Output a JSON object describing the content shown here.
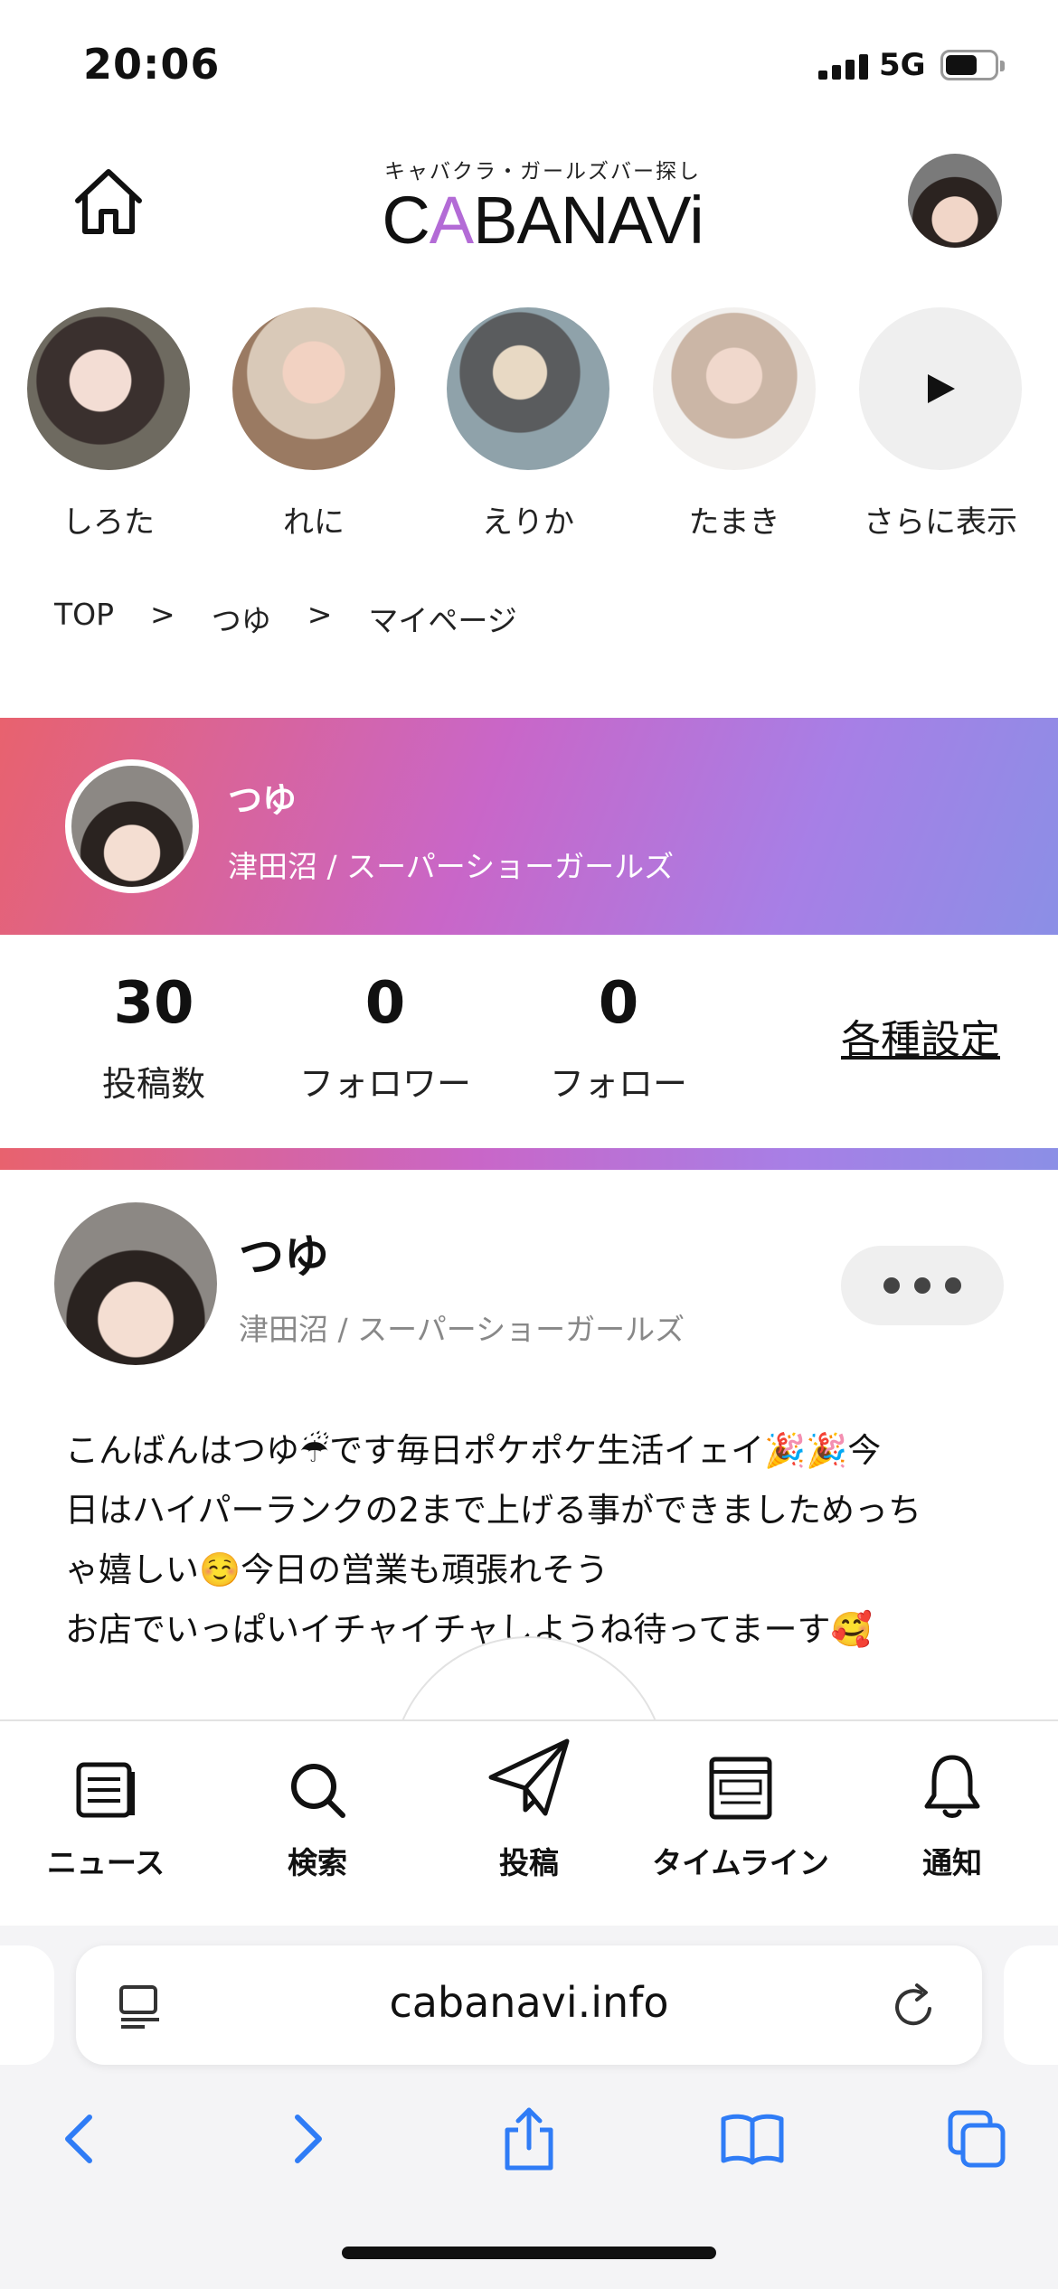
{
  "status_bar": {
    "time": "20:06",
    "network": "5G"
  },
  "header": {
    "logo_sub": "キャバクラ・ガールズバー探し",
    "logo_main_a": "C",
    "logo_main_accent": "A",
    "logo_main_b": "BANAVi"
  },
  "stories": [
    {
      "name": "しろた"
    },
    {
      "name": "れに"
    },
    {
      "name": "えりか"
    },
    {
      "name": "たまき"
    }
  ],
  "stories_more_label": "さらに表示",
  "breadcrumb": {
    "items": [
      "TOP",
      "つゆ",
      "マイページ"
    ],
    "separator": ">"
  },
  "profile": {
    "name": "つゆ",
    "shop": "津田沼 / スーパーショーガールズ"
  },
  "stats": [
    {
      "value": "30",
      "label": "投稿数"
    },
    {
      "value": "0",
      "label": "フォロワー"
    },
    {
      "value": "0",
      "label": "フォロー"
    }
  ],
  "settings_label": "各種設定",
  "post": {
    "name": "つゆ",
    "shop": "津田沼 / スーパーショーガールズ",
    "text": "こんばんはつゆ☔です毎日ポケポケ生活イェイ🎉🎉今\n日はハイパーランクの2まで上げる事ができましためっち\nゃ嬉しい☺️今日の営業も頑張れそう\nお店でいっぱいイチャイチャしようね待ってまーす🥰"
  },
  "tabs": [
    {
      "label": "ニュース",
      "icon": "news-icon"
    },
    {
      "label": "検索",
      "icon": "search-icon"
    },
    {
      "label": "投稿",
      "icon": "paper-plane-icon"
    },
    {
      "label": "タイムライン",
      "icon": "timeline-icon"
    },
    {
      "label": "通知",
      "icon": "bell-icon"
    }
  ],
  "browser": {
    "url": "cabanavi.info"
  },
  "colors": {
    "accent_purple": "#b36bd6",
    "banner_start": "#e8626e",
    "banner_end": "#8b8fe6",
    "safari_blue": "#2f7cf6"
  }
}
